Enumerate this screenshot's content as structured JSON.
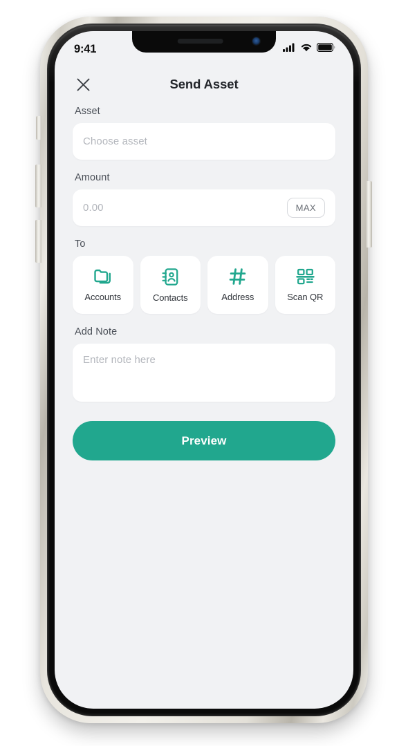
{
  "device": {
    "notch": {
      "speaker_icon": "speaker-grille",
      "camera_icon": "front-camera"
    },
    "buttons": {
      "mute_switch": "mute-switch",
      "volume_up": "volume-up-button",
      "volume_down": "volume-down-button",
      "power": "power-button"
    }
  },
  "status_bar": {
    "time": "9:41",
    "cellular_icon": "cellular-signal-icon",
    "wifi_icon": "wifi-icon",
    "battery_icon": "battery-icon"
  },
  "navbar": {
    "close_icon": "close-icon",
    "title": "Send Asset"
  },
  "form": {
    "asset": {
      "label": "Asset",
      "placeholder": "Choose asset",
      "value": ""
    },
    "amount": {
      "label": "Amount",
      "placeholder": "0.00",
      "value": "",
      "max_label": "MAX"
    },
    "to": {
      "label": "To",
      "options": [
        {
          "label": "Accounts",
          "icon": "folders-icon"
        },
        {
          "label": "Contacts",
          "icon": "address-book-icon"
        },
        {
          "label": "Address",
          "icon": "hash-icon"
        },
        {
          "label": "Scan QR",
          "icon": "qr-code-scan-icon"
        }
      ]
    },
    "note": {
      "label": "Add Note",
      "placeholder": "Enter note here",
      "value": ""
    }
  },
  "actions": {
    "preview_label": "Preview"
  },
  "colors": {
    "accent": "#21a78e",
    "screen_background": "#f1f2f4",
    "card": "#ffffff",
    "title_text": "#22252a",
    "label_text": "#4b5058",
    "placeholder_text": "#b3b6bc"
  }
}
